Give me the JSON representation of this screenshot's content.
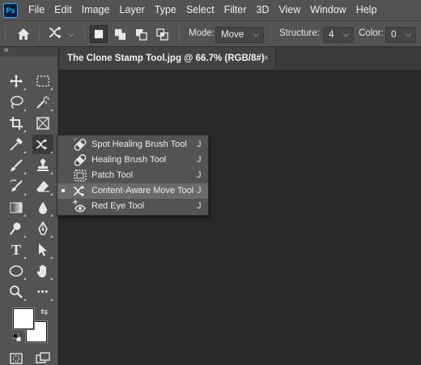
{
  "app": {
    "logo_text": "Ps"
  },
  "menubar": {
    "items": [
      "File",
      "Edit",
      "Image",
      "Layer",
      "Type",
      "Select",
      "Filter",
      "3D",
      "View",
      "Window",
      "Help"
    ]
  },
  "options_bar": {
    "mode_label": "Mode:",
    "mode_value": "Move",
    "structure_label": "Structure:",
    "structure_value": "4",
    "color_label": "Color:",
    "color_value": "0"
  },
  "document": {
    "tab_title": "The Clone Stamp Tool.jpg @ 66.7% (RGB/8#)",
    "close_glyph": "×"
  },
  "toolbar": {
    "collapse_glyph": "«",
    "tools": [
      {
        "name": "move-tool",
        "icon": "move-icon"
      },
      {
        "name": "marquee-tool",
        "icon": "marquee-icon"
      },
      {
        "name": "lasso-tool",
        "icon": "lasso-icon"
      },
      {
        "name": "magic-wand-tool",
        "icon": "magic-wand-icon"
      },
      {
        "name": "crop-tool",
        "icon": "crop-icon"
      },
      {
        "name": "frame-tool",
        "icon": "frame-icon"
      },
      {
        "name": "eyedropper-tool",
        "icon": "eyedropper-icon"
      },
      {
        "name": "content-aware-move-tool",
        "icon": "content-aware-move-icon"
      },
      {
        "name": "brush-tool",
        "icon": "brush-icon"
      },
      {
        "name": "clone-stamp-tool",
        "icon": "stamp-icon"
      },
      {
        "name": "history-brush-tool",
        "icon": "history-brush-icon"
      },
      {
        "name": "eraser-tool",
        "icon": "eraser-icon"
      },
      {
        "name": "gradient-tool",
        "icon": "gradient-icon"
      },
      {
        "name": "blur-tool",
        "icon": "drop-icon"
      },
      {
        "name": "dodge-tool",
        "icon": "dodge-icon"
      },
      {
        "name": "pen-tool",
        "icon": "pen-icon"
      },
      {
        "name": "type-tool",
        "icon": "type-icon"
      },
      {
        "name": "path-selection-tool",
        "icon": "arrow-icon"
      },
      {
        "name": "ellipse-tool",
        "icon": "ellipse-icon"
      },
      {
        "name": "hand-tool",
        "icon": "hand-icon"
      },
      {
        "name": "zoom-tool",
        "icon": "zoom-icon"
      },
      {
        "name": "more-tools",
        "icon": "ellipsis-icon"
      }
    ],
    "type_glyph": "T",
    "more_glyph": "•••",
    "swap_glyph": "⇆",
    "colors": {
      "foreground": "#ffffff",
      "background": "#ffffff"
    }
  },
  "flyout": {
    "items": [
      {
        "label": "Spot Healing Brush Tool",
        "shortcut": "J",
        "icon": "spot-healing-brush-icon",
        "selected": false
      },
      {
        "label": "Healing Brush Tool",
        "shortcut": "J",
        "icon": "healing-brush-icon",
        "selected": false
      },
      {
        "label": "Patch Tool",
        "shortcut": "J",
        "icon": "patch-icon",
        "selected": false
      },
      {
        "label": "Content-Aware Move Tool",
        "shortcut": "J",
        "icon": "content-aware-move-icon",
        "selected": true
      },
      {
        "label": "Red Eye Tool",
        "shortcut": "J",
        "icon": "red-eye-icon",
        "selected": false
      }
    ]
  },
  "theme": {
    "panel": "#535353",
    "canvas": "#282828",
    "accent": "#31a8ff"
  }
}
